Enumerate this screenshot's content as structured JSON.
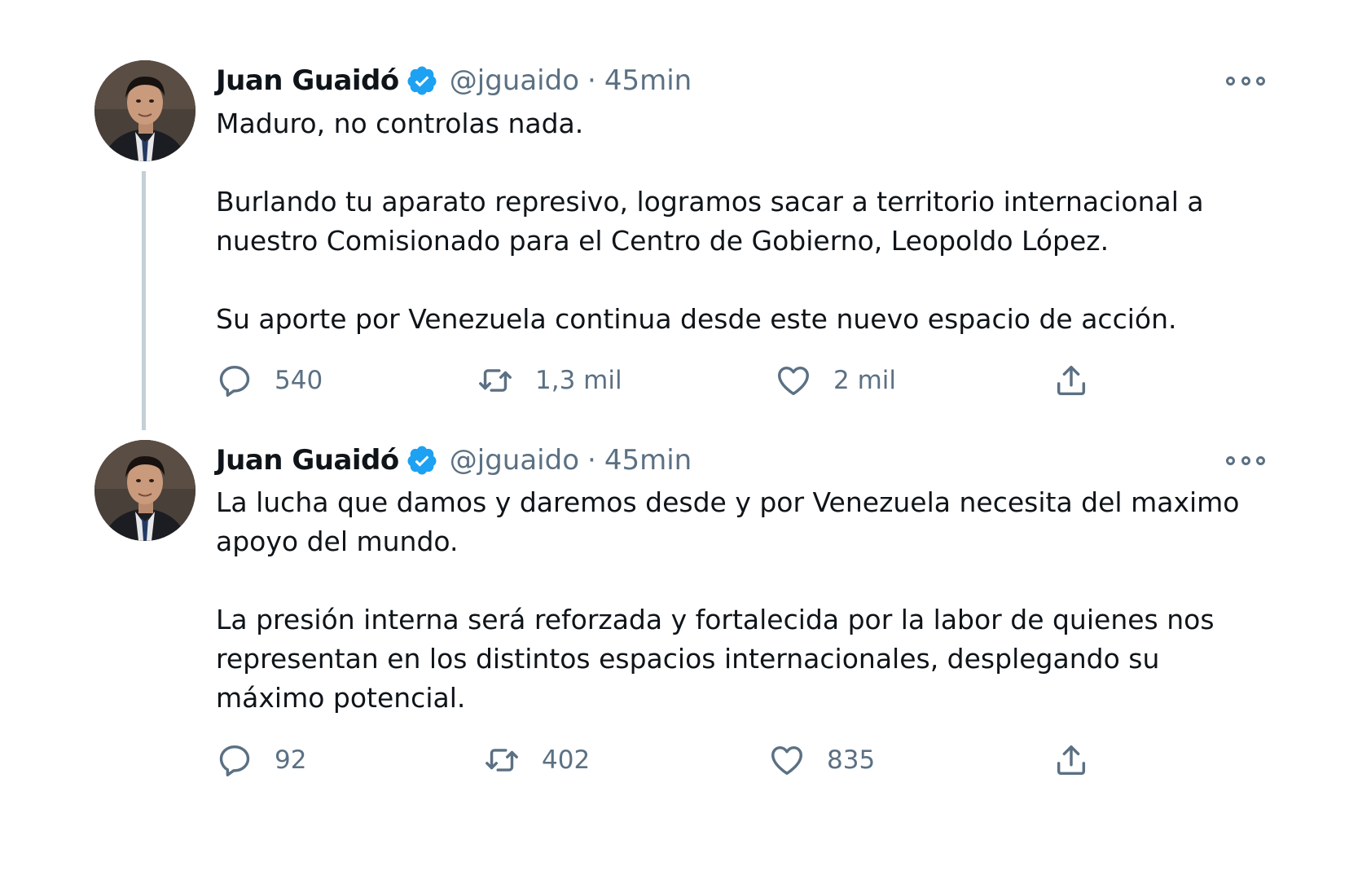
{
  "tweets": [
    {
      "author": "Juan Guaidó",
      "handle": "@jguaido",
      "separator": "·",
      "time": "45min",
      "paragraphs": [
        "Maduro, no controlas nada.",
        "",
        "Burlando tu aparato represivo, logramos sacar a territorio internacional a nuestro Comisionado para el Centro de Gobierno, Leopoldo López.",
        "",
        "Su aporte por Venezuela continua desde este nuevo espacio de acción."
      ],
      "replies": "540",
      "retweets": "1,3 mil",
      "likes": "2 mil"
    },
    {
      "author": "Juan Guaidó",
      "handle": "@jguaido",
      "separator": "·",
      "time": "45min",
      "paragraphs": [
        "La lucha que damos y daremos desde y por Venezuela necesita del maximo apoyo del mundo.",
        "",
        "La presión interna será reforzada y fortalecida por la labor de quienes nos representan en los distintos espacios internacionales, desplegando su máximo potencial."
      ],
      "replies": "92",
      "retweets": "402",
      "likes": "835"
    }
  ],
  "icons": {
    "verified": "verified-badge-icon",
    "more": "more-options-icon",
    "reply": "reply-icon",
    "retweet": "retweet-icon",
    "like": "like-heart-icon",
    "share": "share-icon"
  },
  "colors": {
    "verified": "#1da1f2",
    "secondary_text": "#5b7083",
    "primary_text": "#0f1419",
    "thread_line": "#c4cfd6"
  }
}
